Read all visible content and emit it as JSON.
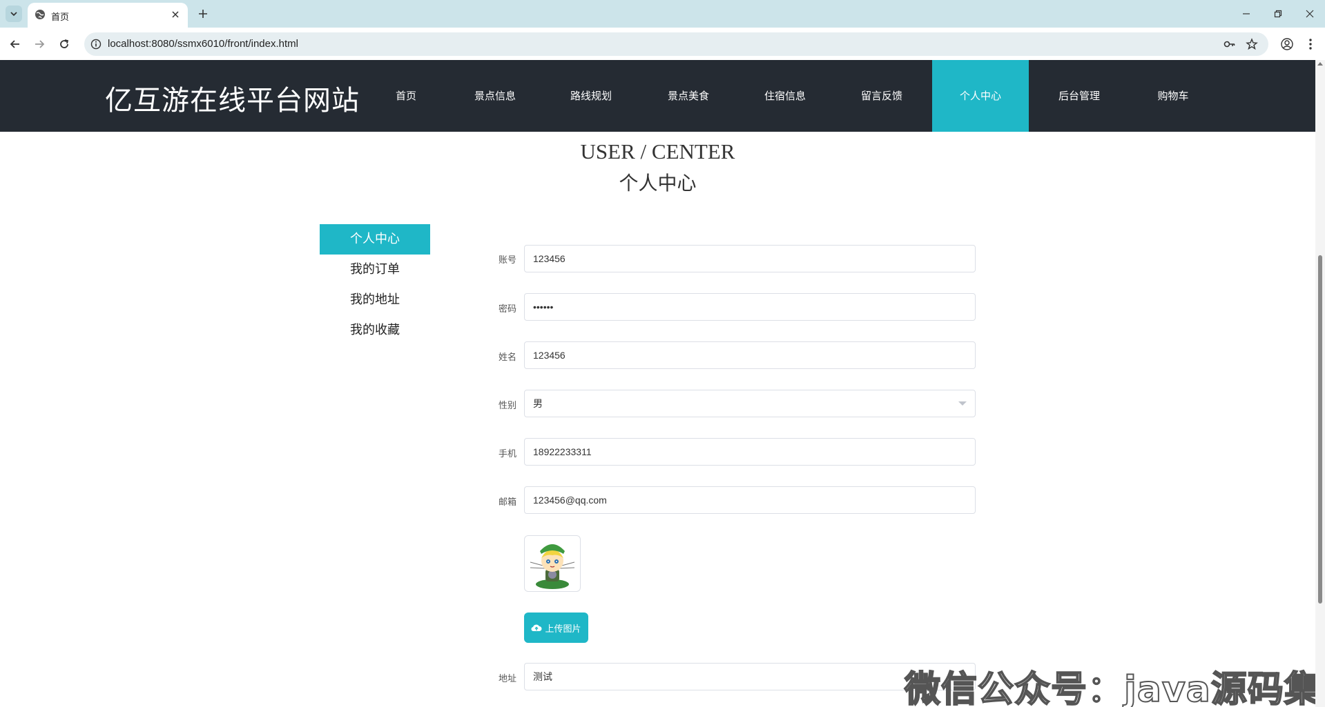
{
  "browser": {
    "tab_title": "首页",
    "url": "localhost:8080/ssmx6010/front/index.html"
  },
  "site": {
    "title": "亿互游在线平台网站",
    "nav": [
      {
        "label": "首页"
      },
      {
        "label": "景点信息"
      },
      {
        "label": "路线规划"
      },
      {
        "label": "景点美食"
      },
      {
        "label": "住宿信息"
      },
      {
        "label": "留言反馈"
      },
      {
        "label": "个人中心",
        "active": true
      },
      {
        "label": "后台管理"
      },
      {
        "label": "购物车"
      }
    ],
    "accent_color": "#1fb7c7",
    "header_color": "#252b33"
  },
  "section": {
    "title_en": "USER / CENTER",
    "title_zh": "个人中心"
  },
  "side_menu": [
    {
      "label": "个人中心",
      "active": true
    },
    {
      "label": "我的订单"
    },
    {
      "label": "我的地址"
    },
    {
      "label": "我的收藏"
    }
  ],
  "form": {
    "account_label": "账号",
    "account_value": "123456",
    "password_label": "密码",
    "password_value": "••••••",
    "name_label": "姓名",
    "name_value": "123456",
    "gender_label": "性别",
    "gender_value": "男",
    "phone_label": "手机",
    "phone_value": "18922233311",
    "email_label": "邮箱",
    "email_value": "123456@qq.com",
    "upload_label": "上传图片",
    "address_label": "地址",
    "address_value": "测试"
  },
  "watermark": "微信公众号：java源码集合"
}
